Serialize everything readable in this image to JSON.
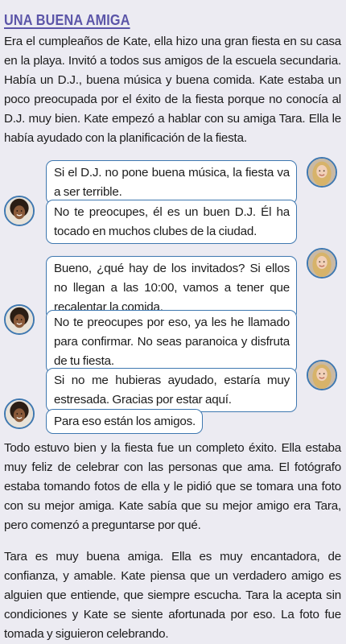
{
  "title": "UNA BUENA AMIGA",
  "intro": "Era el cumpleaños de Kate, ella hizo una gran fiesta en su casa en la playa. Invitó a todos sus amigos de la escuela secundaria. Había un D.J., buena música y buena comida. Kate estaba un poco preocupada por el éxito de la fiesta porque no conocía al D.J. muy bien. Kate empezó a hablar con su amiga Tara. Ella le había ayudado con la planificación de la fiesta.",
  "chat": [
    {
      "speaker": "Kate",
      "text": "Si el D.J. no pone buena música, la fiesta va a ser terrible."
    },
    {
      "speaker": "Tara",
      "text": "No te preocupes, él es un buen D.J. Él ha tocado en muchos clubes de la ciudad."
    },
    {
      "speaker": "Kate",
      "text": "Bueno, ¿qué hay de los invitados? Si ellos no llegan a las 10:00, vamos a tener que recalentar la comida."
    },
    {
      "speaker": "Tara",
      "text": "No te preocupes por eso, ya les he llamado para confirmar. No seas paranoica y disfruta de tu fiesta."
    },
    {
      "speaker": "Kate",
      "text": "Si no me hubieras ayudado, estaría muy estresada. Gracias por estar aquí."
    },
    {
      "speaker": "Tara",
      "text": "Para eso están los amigos."
    }
  ],
  "paragraph2": "Todo estuvo  bien y la fiesta fue un completo éxito. Ella estaba muy feliz de celebrar con las personas que ama. El fotógrafo estaba tomando fotos de ella y le pidió que se tomara una foto con su mejor amiga. Kate sabía que su mejor amigo era Tara, pero comenzó a preguntarse por qué.",
  "paragraph3": "Tara es  muy buena amiga. Ella es muy encantadora, de confianza, y amable. Kate piensa que un verdadero amigo es alguien que entiende, que siempre escucha. Tara la acepta sin condiciones y Kate se siente afortunada por eso. La foto fue tomada y siguieron celebrando.",
  "colors": {
    "title": "#5b55a8",
    "bubble_border": "#3f78b0",
    "background": "#ecebf2"
  }
}
